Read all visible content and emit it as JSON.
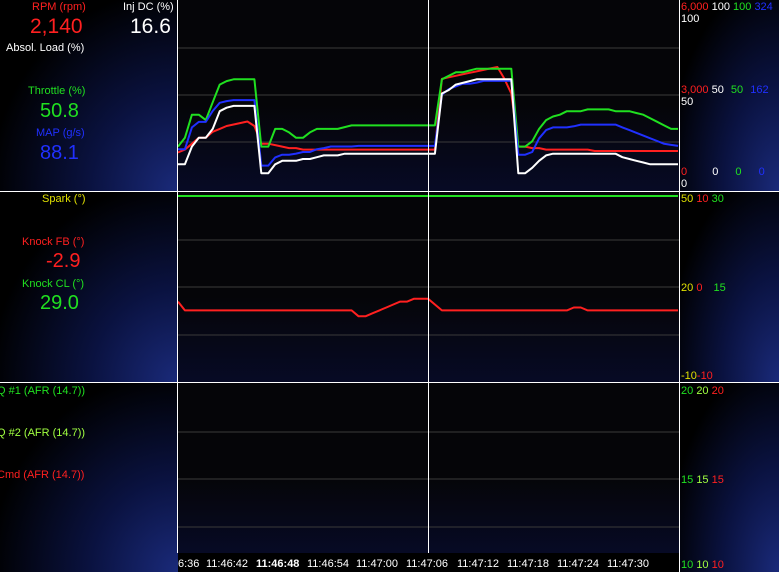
{
  "colors": {
    "red": "#ff2020",
    "white": "#ffffff",
    "green": "#20e020",
    "blue": "#2030ff",
    "yellow": "#e0e000",
    "lightgreen": "#a0ff40"
  },
  "panels": [
    {
      "labels": [
        {
          "text": "RPM (rpm)",
          "value": "2,140",
          "color": "red"
        },
        {
          "text": "Inj DC (%)",
          "value": "16.6",
          "color": "white"
        },
        {
          "text": "Absol. Load (%)",
          "value": "",
          "color": "white"
        },
        {
          "text": "Throttle (%)",
          "value": "50.8",
          "color": "green"
        },
        {
          "text": "MAP (g/s)",
          "value": "88.1",
          "color": "blue"
        }
      ],
      "scale_top": [
        {
          "text": "6,000",
          "color": "red"
        },
        {
          "text": "100",
          "color": "white"
        },
        {
          "text": "100",
          "color": "green"
        },
        {
          "text": "324",
          "color": "blue"
        }
      ],
      "scale_top2": "100",
      "scale_mid": [
        {
          "text": "3,000",
          "color": "red"
        },
        {
          "text": "50",
          "color": "white"
        },
        {
          "text": "50",
          "color": "green"
        },
        {
          "text": "162",
          "color": "blue"
        }
      ],
      "scale_mid2": "50",
      "scale_bot": [
        {
          "text": "0",
          "color": "red"
        },
        {
          "text": "0",
          "color": "white"
        },
        {
          "text": "0",
          "color": "green"
        },
        {
          "text": "0",
          "color": "blue"
        }
      ],
      "scale_bot2": "0"
    },
    {
      "labels": [
        {
          "text": "Spark (°)",
          "value": "",
          "color": "yellow"
        },
        {
          "text": "Knock FB (°)",
          "value": "-2.9",
          "color": "red"
        },
        {
          "text": "Knock CL (°)",
          "value": "29.0",
          "color": "green"
        }
      ],
      "scale_top": [
        {
          "text": "50",
          "color": "yellow"
        },
        {
          "text": "10",
          "color": "red"
        },
        {
          "text": "30",
          "color": "green"
        }
      ],
      "scale_mid": [
        {
          "text": "20",
          "color": "yellow"
        },
        {
          "text": "0",
          "color": "red"
        },
        {
          "text": "15",
          "color": "green"
        }
      ],
      "scale_bot": [
        {
          "text": "-10",
          "color": "yellow"
        },
        {
          "text": "-10",
          "color": "red"
        }
      ]
    },
    {
      "labels": [
        {
          "text": "Q #1 (AFR (14.7))",
          "color": "green"
        },
        {
          "text": "Q #2 (AFR (14.7))",
          "color": "lightgreen"
        },
        {
          "text": "Cmd (AFR (14.7))",
          "color": "red"
        }
      ],
      "scale_top": [
        {
          "text": "20",
          "color": "green"
        },
        {
          "text": "20",
          "color": "lightgreen"
        },
        {
          "text": "20",
          "color": "red"
        }
      ],
      "scale_mid": [
        {
          "text": "15",
          "color": "green"
        },
        {
          "text": "15",
          "color": "lightgreen"
        },
        {
          "text": "15",
          "color": "red"
        }
      ],
      "scale_bot": [
        {
          "text": "10",
          "color": "green"
        },
        {
          "text": "10",
          "color": "lightgreen"
        },
        {
          "text": "10",
          "color": "red"
        }
      ]
    }
  ],
  "time_ticks": [
    "6:36",
    "11:46:42",
    "11:46:48",
    "11:46:54",
    "11:47:00",
    "11:47:06",
    "11:47:12",
    "11:47:18",
    "11:47:24",
    "11:47:30"
  ],
  "cursor_time": "11:46:48",
  "chart_data": {
    "type": "line",
    "x": [
      0,
      0.5,
      1,
      1.5,
      2,
      2.5,
      3,
      3.5,
      4,
      4.5,
      5,
      5.5,
      6,
      6.5,
      7,
      7.5,
      8,
      8.5,
      9,
      9.5,
      10,
      10.5,
      11,
      11.5,
      12,
      12.5,
      13,
      13.5,
      14,
      14.5,
      15,
      15.5,
      16,
      16.5,
      17,
      17.5,
      18,
      18.5,
      19,
      19.5,
      20,
      20.5,
      21,
      21.5,
      22,
      22.5,
      23,
      23.5,
      24,
      24.5,
      25,
      25.5,
      26,
      26.5,
      27,
      27.5,
      28,
      28.5,
      29,
      29.5,
      30,
      30.5,
      31,
      31.5,
      32,
      32.5,
      33,
      33.5,
      34,
      34.5,
      35,
      35.5,
      36
    ],
    "x_axis": "time (s), elapsed",
    "series": [
      {
        "name": "RPM (rpm)",
        "color": "red",
        "axis": [
          0,
          6000
        ],
        "values": [
          1000,
          1100,
          1300,
          1500,
          1500,
          1700,
          1800,
          1900,
          1950,
          2000,
          2050,
          1900,
          1300,
          1300,
          1250,
          1200,
          1150,
          1150,
          1100,
          1100,
          1100,
          1100,
          1100,
          1100,
          1100,
          1100,
          1100,
          1100,
          1100,
          1100,
          1100,
          1100,
          1100,
          1100,
          1100,
          1100,
          1100,
          1100,
          3500,
          3550,
          3600,
          3650,
          3700,
          3750,
          3800,
          3850,
          3900,
          3500,
          3000,
          1200,
          1200,
          1150,
          1150,
          1100,
          1100,
          1100,
          1100,
          1100,
          1100,
          1100,
          1050,
          1050,
          1050,
          1050,
          1050,
          1050,
          1050,
          1050,
          1050,
          1050,
          1050,
          1050,
          1050
        ]
      },
      {
        "name": "Throttle (%)",
        "color": "green",
        "axis": [
          0,
          100
        ],
        "values": [
          20,
          25,
          38,
          38,
          35,
          45,
          55,
          57,
          58,
          58,
          58,
          58,
          20,
          20,
          30,
          30,
          28,
          25,
          25,
          28,
          30,
          30,
          30,
          30,
          31,
          32,
          32,
          32,
          32,
          32,
          32,
          32,
          32,
          32,
          32,
          32,
          32,
          32,
          58,
          60,
          62,
          62,
          63,
          64,
          64,
          64,
          64,
          64,
          64,
          20,
          20,
          23,
          30,
          35,
          37,
          38,
          40,
          40,
          40,
          41,
          41,
          41,
          41,
          40,
          40,
          40,
          39,
          38,
          36,
          34,
          32,
          30,
          30
        ]
      },
      {
        "name": "MAP (g/s)",
        "color": "blue",
        "axis": [
          0,
          324
        ],
        "values": [
          60,
          60,
          100,
          110,
          110,
          130,
          145,
          148,
          150,
          150,
          150,
          150,
          30,
          30,
          45,
          50,
          50,
          52,
          55,
          55,
          60,
          62,
          65,
          65,
          65,
          65,
          66,
          66,
          66,
          66,
          66,
          66,
          66,
          66,
          66,
          66,
          66,
          66,
          160,
          170,
          175,
          180,
          180,
          182,
          185,
          185,
          185,
          185,
          185,
          50,
          50,
          55,
          80,
          95,
          100,
          100,
          100,
          102,
          105,
          105,
          105,
          105,
          105,
          105,
          100,
          95,
          90,
          85,
          80,
          75,
          70,
          68,
          66
        ]
      },
      {
        "name": "Inj DC (%)",
        "color": "white",
        "axis": [
          0,
          100
        ],
        "values": [
          10,
          10,
          20,
          25,
          25,
          30,
          40,
          42,
          43,
          43,
          43,
          43,
          5,
          5,
          10,
          12,
          12,
          12,
          13,
          13,
          14,
          15,
          15,
          15,
          16,
          16,
          16,
          16,
          16,
          16,
          16,
          16,
          16,
          16,
          16,
          16,
          16,
          16,
          50,
          52,
          55,
          56,
          57,
          58,
          58,
          58,
          58,
          58,
          58,
          5,
          5,
          8,
          12,
          15,
          16,
          16,
          16,
          16,
          16,
          16,
          16,
          16,
          16,
          16,
          14,
          13,
          12,
          11,
          10,
          10,
          10,
          10,
          10
        ]
      },
      {
        "name": "Spark (°)",
        "color": "green",
        "panel": 1,
        "axis": [
          -10,
          50
        ],
        "values": [
          50,
          50,
          50,
          50,
          50,
          50,
          50,
          50,
          50,
          50,
          50,
          50,
          50,
          50,
          50,
          50,
          50,
          50,
          50,
          50,
          50,
          50,
          50,
          50,
          50,
          50,
          50,
          50,
          50,
          50,
          50,
          50,
          50,
          50,
          50,
          50,
          50,
          50,
          50,
          50,
          50,
          50,
          50,
          50,
          50,
          50,
          50,
          50,
          50,
          50,
          50,
          50,
          50,
          50,
          50,
          50,
          50,
          50,
          50,
          50,
          50,
          50,
          50,
          50,
          50,
          50,
          50,
          50,
          50,
          50,
          50,
          50,
          50
        ]
      },
      {
        "name": "Knock FB (°)",
        "color": "red",
        "panel": 1,
        "axis": [
          -10,
          50
        ],
        "values": [
          14,
          11,
          11,
          11,
          11,
          11,
          11,
          11,
          11,
          11,
          11,
          11,
          11,
          11,
          11,
          11,
          11,
          11,
          11,
          11,
          11,
          11,
          11,
          11,
          11,
          11,
          9,
          9,
          10,
          11,
          12,
          13,
          14,
          14,
          15,
          15,
          15,
          13,
          11,
          11,
          11,
          11,
          11,
          11,
          11,
          11,
          11,
          11,
          11,
          11,
          11,
          11,
          11,
          11,
          11,
          11,
          11,
          12,
          12,
          11,
          11,
          11,
          11,
          11,
          11,
          11,
          11,
          11,
          11,
          11,
          11,
          11,
          11
        ]
      }
    ]
  }
}
